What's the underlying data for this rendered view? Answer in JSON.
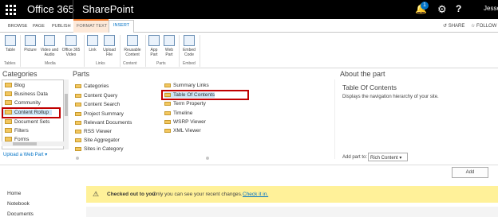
{
  "suite": {
    "app_launcher": "waffle-icon",
    "brand": "Office 365",
    "site": "SharePoint",
    "notification_count": "1",
    "user": "Jesse V"
  },
  "ribbon_tabs": [
    "BROWSE",
    "PAGE",
    "PUBLISH",
    "FORMAT TEXT",
    "INSERT"
  ],
  "actions": {
    "share": "SHARE",
    "follow": "FOLLOW"
  },
  "ribbon": {
    "buttons": [
      {
        "label": "Table"
      },
      {
        "label": "Picture"
      },
      {
        "label": "Video and Audio"
      },
      {
        "label": "Office 365 Video"
      },
      {
        "label": "Link"
      },
      {
        "label": "Upload File"
      },
      {
        "label": "Reusable Content"
      },
      {
        "label": "App Part"
      },
      {
        "label": "Web Part"
      },
      {
        "label": "Embed Code"
      }
    ],
    "groups": [
      "Tables",
      "Media",
      "Links",
      "Content",
      "Parts",
      "Embed"
    ]
  },
  "categories": {
    "header": "Categories",
    "items": [
      "Blog",
      "Business Data",
      "Community",
      "Content Rollup",
      "Document Sets",
      "Filters",
      "Forms"
    ],
    "selected": "Content Rollup",
    "upload": "Upload a Web Part"
  },
  "parts": {
    "header": "Parts",
    "col1": [
      "Categories",
      "Content Query",
      "Content Search",
      "Project Summary",
      "Relevant Documents",
      "RSS Viewer",
      "Site Aggregator",
      "Sites in Category"
    ],
    "col2": [
      "Summary Links",
      "Table Of Contents",
      "Term Property",
      "Timeline",
      "WSRP Viewer",
      "XML Viewer"
    ],
    "selected": "Table Of Contents"
  },
  "about": {
    "header": "About the part",
    "title": "Table Of Contents",
    "description": "Displays the navigation hierarchy of your site.",
    "add_to_label": "Add part to:",
    "add_to_value": "Rich Content"
  },
  "add_button": "Add",
  "leftnav": [
    "Home",
    "Notebook",
    "Documents"
  ],
  "notice": {
    "bold": "Checked out to you",
    "text": "Only you can see your recent changes.",
    "link": "Check it in."
  }
}
